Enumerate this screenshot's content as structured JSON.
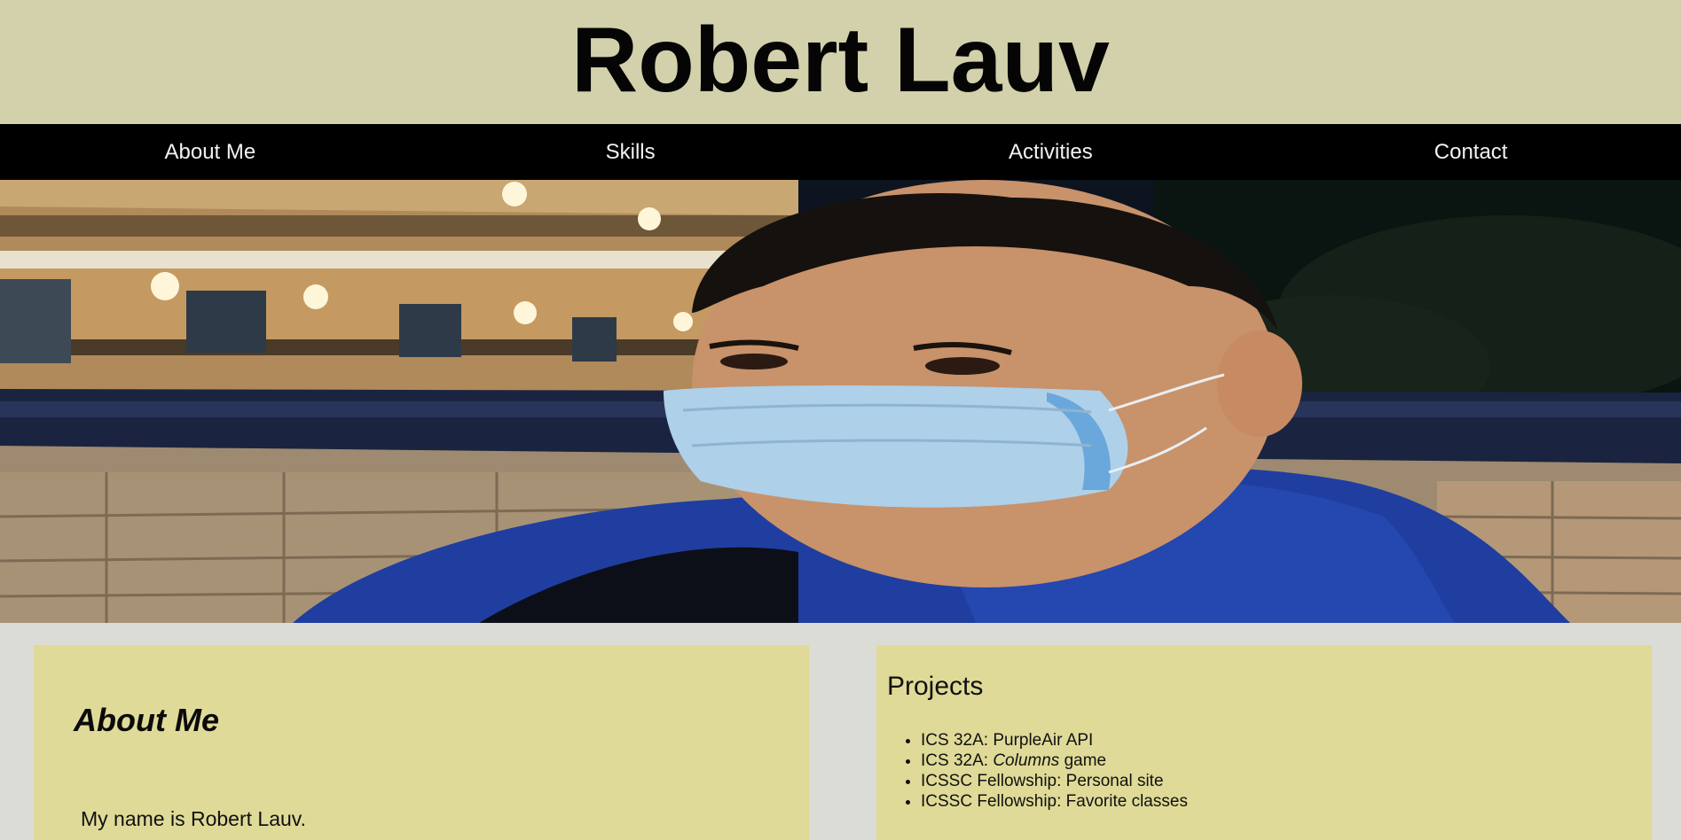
{
  "header": {
    "title": "Robert Lauv"
  },
  "nav": {
    "items": [
      {
        "label": "About Me"
      },
      {
        "label": "Skills"
      },
      {
        "label": "Activities"
      },
      {
        "label": "Contact"
      }
    ]
  },
  "about": {
    "heading": "About Me",
    "text": "My name is Robert Lauv."
  },
  "projects": {
    "heading": "Projects",
    "items": [
      {
        "prefix": "ICS 32A: ",
        "emphasis": "",
        "suffix": "PurpleAir API"
      },
      {
        "prefix": "ICS 32A: ",
        "emphasis": "Columns",
        "suffix": " game"
      },
      {
        "prefix": "ICSSC Fellowship: ",
        "emphasis": "",
        "suffix": "Personal site"
      },
      {
        "prefix": "ICSSC Fellowship: ",
        "emphasis": "",
        "suffix": "Favorite classes"
      }
    ]
  },
  "colors": {
    "header_bg": "#d2d1ab",
    "nav_bg": "#000000",
    "page_bg": "#dcdcd7",
    "panel_bg": "#dfda97"
  }
}
